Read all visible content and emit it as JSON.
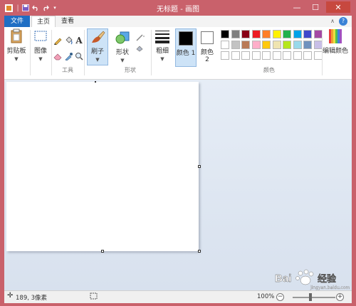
{
  "window": {
    "title": "无标题 - 画图",
    "minimize": "—",
    "maximize": "☐",
    "close": "✕",
    "quick_access": [
      "save-icon",
      "undo-icon",
      "redo-icon",
      "customize-icon"
    ]
  },
  "tabs": {
    "file": "文件",
    "home": "主页",
    "view": "查看"
  },
  "ribbon": {
    "clipboard": {
      "label": "剪贴板"
    },
    "image": {
      "label": "图像"
    },
    "tools": {
      "group_label": "工具"
    },
    "brushes": {
      "label": "刷子"
    },
    "shapes": {
      "label": "形状",
      "group_label": "形状"
    },
    "size": {
      "label": "粗细"
    },
    "color1": {
      "label": "颜色 1",
      "value": "#000000"
    },
    "color2": {
      "label": "颜色 2",
      "value": "#ffffff"
    },
    "colors": {
      "group_label": "颜色",
      "row1": [
        "#000000",
        "#7f7f7f",
        "#880015",
        "#ed1c24",
        "#ff7f27",
        "#fff200",
        "#22b14c",
        "#00a2e8",
        "#3f48cc",
        "#a349a4"
      ],
      "row2": [
        "#ffffff",
        "#c3c3c3",
        "#b97a57",
        "#ffaec9",
        "#ffc90e",
        "#efe4b0",
        "#b5e61d",
        "#99d9ea",
        "#7092be",
        "#c8bfe7"
      ],
      "row3": [
        "#ffffff",
        "#ffffff",
        "#ffffff",
        "#ffffff",
        "#ffffff",
        "#ffffff",
        "#ffffff",
        "#ffffff",
        "#ffffff",
        "#ffffff"
      ]
    },
    "edit_colors": {
      "label": "编辑颜色"
    }
  },
  "status": {
    "cursor_pos": "189, 3像素",
    "zoom": "100%",
    "zoom_out": "−",
    "zoom_in": "+"
  },
  "watermark": {
    "text": "Bai 经验",
    "sub": "jingyan.baidu.com"
  }
}
